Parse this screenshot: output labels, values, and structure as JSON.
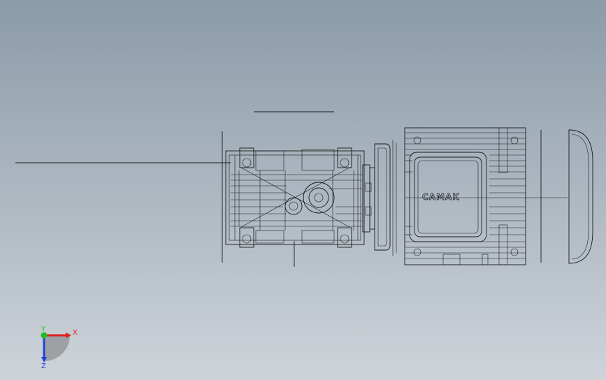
{
  "model": {
    "brand_text": "CAMAK"
  },
  "triad": {
    "x_label": "X",
    "y_label": "Y",
    "z_label": "Z",
    "x_color": "#e02020",
    "y_color": "#20c020",
    "z_color": "#2040e0"
  },
  "colors": {
    "background_top": "#8c9ba9",
    "background_bottom": "#cdd3d9",
    "line": "#1a1a1a"
  }
}
